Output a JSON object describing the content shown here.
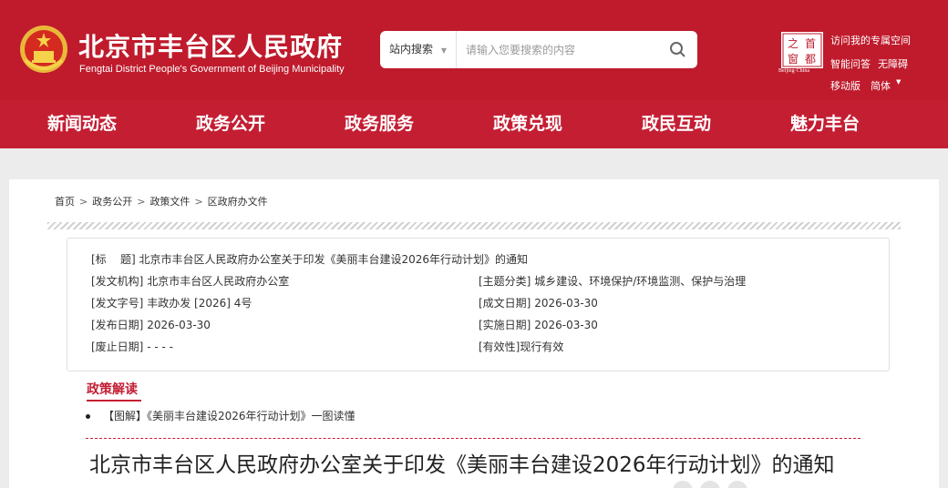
{
  "header": {
    "title": "北京市丰台区人民政府",
    "subtitle": "Fengtai District People's Government of Beijing Municipality",
    "search": {
      "scope": "站内搜索",
      "placeholder": "请输入您要搜索的内容"
    },
    "capital_logo_chars": [
      "首",
      "都",
      "之",
      "窗"
    ],
    "capital_caption": "Beijing·China",
    "links": {
      "personal": "访问我的专属空间",
      "qa": "智能问答",
      "accessible": "无障碍",
      "mobile": "移动版",
      "lang": "简体"
    }
  },
  "nav": [
    "新闻动态",
    "政务公开",
    "政务服务",
    "政策兑现",
    "政民互动",
    "魅力丰台"
  ],
  "breadcrumb": [
    "首页",
    "政务公开",
    "政策文件",
    "区政府办文件"
  ],
  "meta": {
    "title_label": "[标    题]",
    "title_value": "北京市丰台区人民政府办公室关于印发《美丽丰台建设2026年行动计划》的通知",
    "issuer_label": "[发文机构]",
    "issuer_value": "北京市丰台区人民政府办公室",
    "topic_label": "[主题分类]",
    "topic_value": "城乡建设、环境保护/环境监测、保护与治理",
    "docno_label": "[发文字号]",
    "docno_value": "丰政办发 [2026] 4号",
    "created_label": "[成文日期]",
    "created_value": "2026-03-30",
    "published_label": "[发布日期]",
    "published_value": "2026-03-30",
    "effective_label": "[实施日期]",
    "effective_value": "2026-03-30",
    "expired_label": "[废止日期]",
    "expired_value": "- - - -",
    "validity_label": "[有效性]",
    "validity_value": "现行有效"
  },
  "interpretation": {
    "heading": "政策解读",
    "item": "【图解】《美丽丰台建设2026年行动计划》一图读懂"
  },
  "article": {
    "title": "北京市丰台区人民政府办公室关于印发《美丽丰台建设2026年行动计划》的通知"
  },
  "colors": {
    "brand_red": "#bf1b2c",
    "nav_red": "#c41e33"
  }
}
